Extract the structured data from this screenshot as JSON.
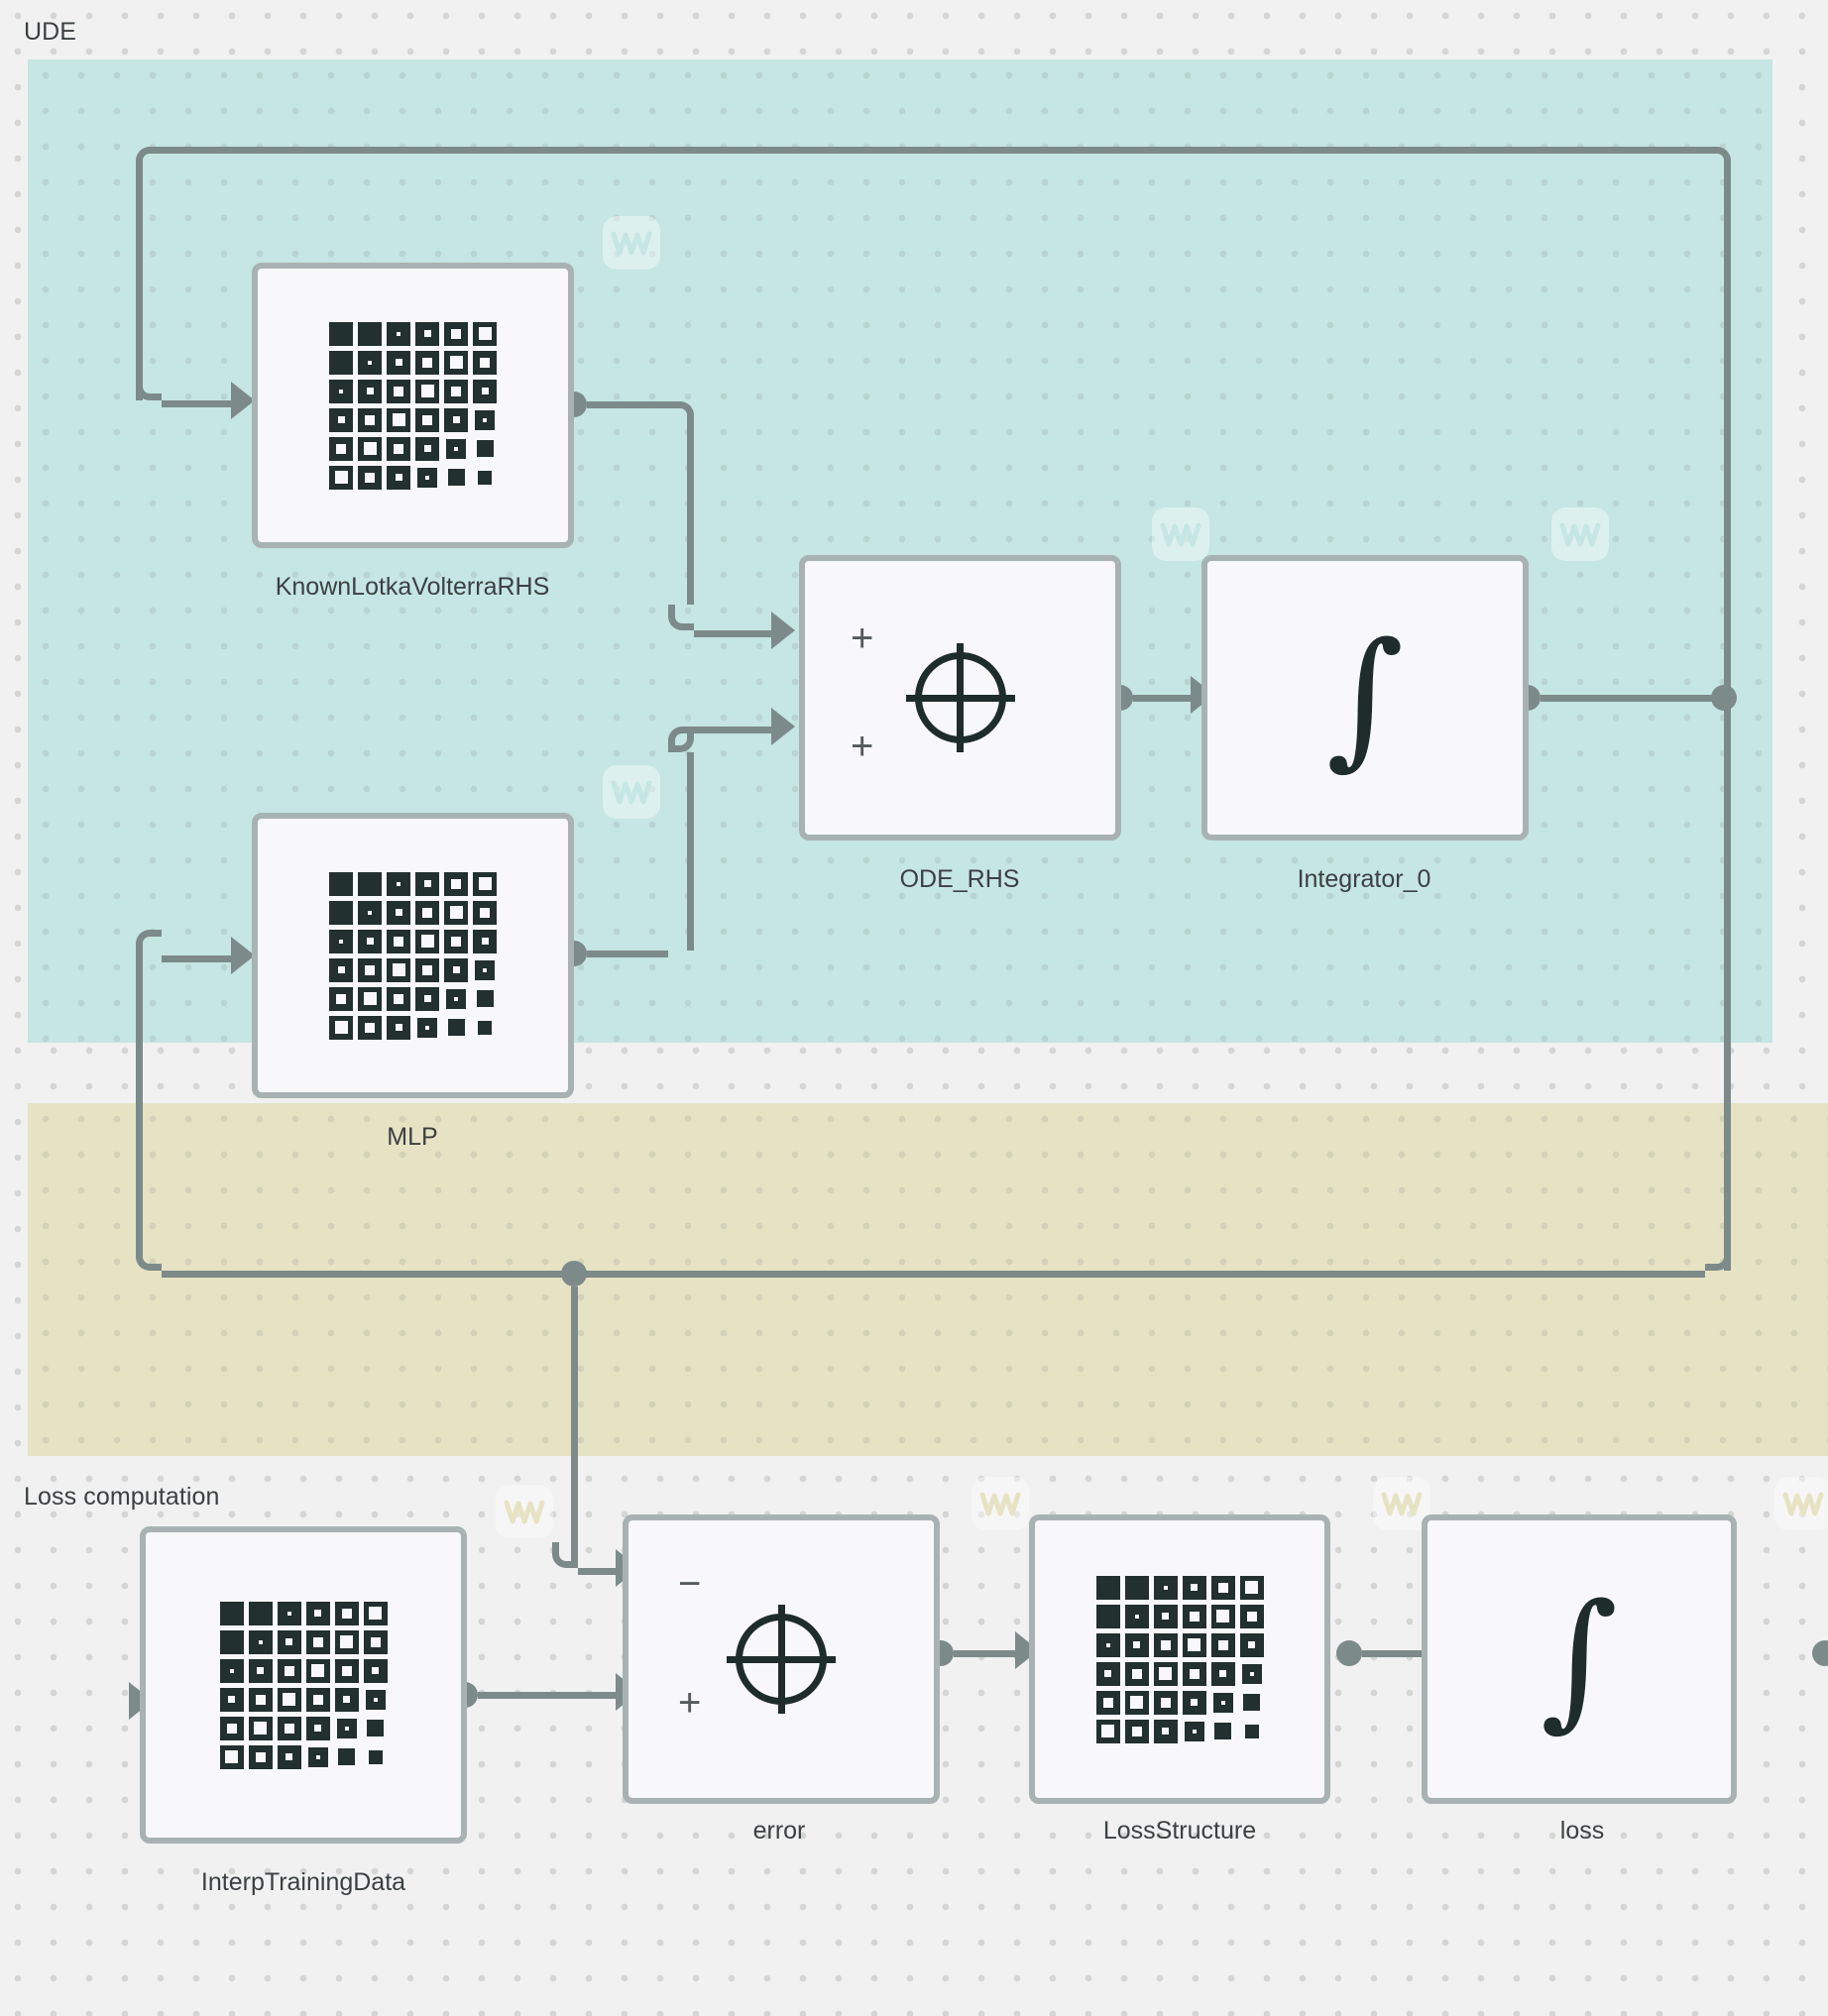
{
  "regions": [
    {
      "id": "ude",
      "label": "UDE",
      "color": "#c5e6e2"
    },
    {
      "id": "loss",
      "label": "Loss computation",
      "color": "#e6e3c4"
    }
  ],
  "blocks": [
    {
      "id": "known_rhs",
      "label": "KnownLotkaVolterraRHS",
      "icon": "matrix-icon",
      "inputs": [],
      "outputs": [
        "out"
      ]
    },
    {
      "id": "mlp",
      "label": "MLP",
      "icon": "matrix-icon",
      "inputs": [],
      "outputs": [
        "out"
      ]
    },
    {
      "id": "ode_rhs",
      "label": "ODE_RHS",
      "icon": "circle-plus-icon",
      "inputs": [
        "+",
        "+"
      ],
      "outputs": [
        "out"
      ]
    },
    {
      "id": "integrator",
      "label": "Integrator_0",
      "icon": "integral-icon",
      "inputs": [
        "in"
      ],
      "outputs": [
        "out"
      ]
    },
    {
      "id": "interp_data",
      "label": "InterpTrainingData",
      "icon": "matrix-icon",
      "inputs": [],
      "outputs": [
        "out"
      ]
    },
    {
      "id": "error",
      "label": "error",
      "icon": "circle-plus-icon",
      "inputs": [
        "−",
        "+"
      ],
      "outputs": [
        "out"
      ]
    },
    {
      "id": "loss_struct",
      "label": "LossStructure",
      "icon": "matrix-icon",
      "inputs": [
        "in"
      ],
      "outputs": [
        "out"
      ]
    },
    {
      "id": "loss_block",
      "label": "loss",
      "icon": "integral-icon",
      "inputs": [
        "in"
      ],
      "outputs": [
        "out"
      ]
    }
  ],
  "port_signs": {
    "ode_rhs_top": "+",
    "ode_rhs_bottom": "+",
    "error_top": "−",
    "error_bottom": "+"
  },
  "icons": {
    "watermark": "scope-wave-icon",
    "integral": "∫"
  },
  "colors": {
    "canvas_bg": "#f0f1f0",
    "ude_region": "#c5e6e2",
    "loss_region": "#e6e3c4",
    "wire": "#7d8a8a",
    "block_fill": "#f8f8fa",
    "block_border": "#a9b2b2",
    "glyph": "#1e2d2c",
    "text": "#3c4043"
  }
}
